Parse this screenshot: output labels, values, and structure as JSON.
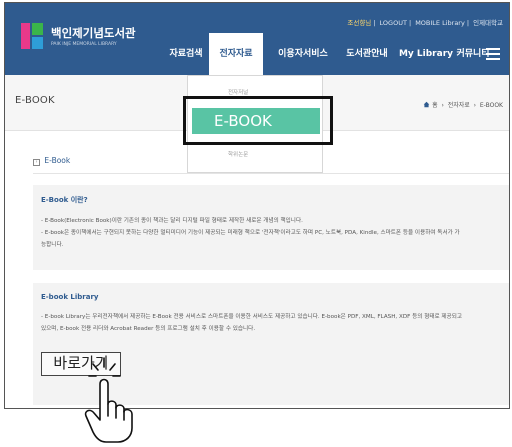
{
  "header": {
    "top_links": {
      "user": "조선향님",
      "logout": "LOGOUT",
      "mobile": "MOBILE Library",
      "univ": "인제대학교"
    },
    "logo": {
      "name": "백인제기념도서관",
      "sub": "PAIK INJE MEMORIAL LIBRARY"
    },
    "nav": [
      "자료검색",
      "전자자료",
      "이용자서비스",
      "도서관안내",
      "My Library",
      "커뮤니티"
    ],
    "active_nav": "전자자료",
    "menu_icon": "hamburger-menu-icon"
  },
  "subbar": {
    "title": "E-BOOK",
    "breadcrumb": [
      "홈",
      "전자자료",
      "E-BOOK"
    ]
  },
  "dropdown": {
    "items_top": "전자저널",
    "active": "E-BOOK",
    "items_bottom": "학위논문"
  },
  "content": {
    "section_head": "E-Book",
    "panel1": {
      "title": "E-Book 이란?",
      "lines": [
        "- E-Book(Electronic Book)이란 기존의 종이 책과는 달리 디지털 파일 형태로 제작한 새로운 개념의 책입니다.",
        "- E-book은 종이책에서는 구현되지 못하는 다양한 멀티미디어 기능이 제공되는 미래형 책으로 '전자책'이라고도 하며 PC, 노트북, PDA, Kindle, 스마트폰 등을 이용하여 독서가 가",
        "능합니다."
      ]
    },
    "panel2": {
      "title": "E-book Library",
      "lines": [
        "- E-book Library는 우리전자책에서 제공하는 E-Book 전용 서비스로 스마트폰을 이용한 서비스도 제공하고 있습니다. E-book은 PDF, XML, FLASH, XDF 등의 형태로 제공되고",
        "있으며, E-book 전용 리더와 Acrobat Reader 등의 프로그램 설치 후 이용할 수 있습니다."
      ],
      "button": "바로가기"
    }
  },
  "overlay": {
    "pointer_icon": "hand-pointer-icon",
    "highlight_color": "#111111"
  },
  "colors": {
    "header_bg": "#2f5b8f",
    "accent_green": "#59c4a4",
    "panel_bg": "#f3f3f3"
  }
}
